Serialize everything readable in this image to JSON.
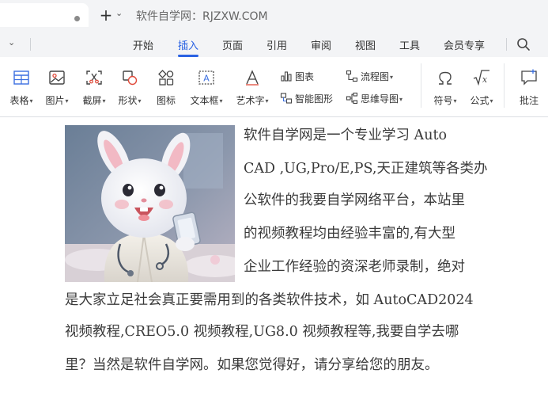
{
  "titlebar": {
    "new_tab_symbol": "+",
    "site_title": "软件自学网：RJZXW.COM"
  },
  "menu": {
    "items": [
      "开始",
      "插入",
      "页面",
      "引用",
      "审阅",
      "视图",
      "工具",
      "会员专享"
    ],
    "active": "插入"
  },
  "ribbon": {
    "table": "表格",
    "picture": "图片",
    "screenshot": "截屏",
    "shape": "形状",
    "icon": "图标",
    "textbox": "文本框",
    "wordart": "艺术字",
    "chart": "图表",
    "smartart": "智能图形",
    "flowchart": "流程图",
    "mindmap": "思维导图",
    "symbol": "符号",
    "formula": "公式",
    "comment": "批注"
  },
  "document": {
    "lines": [
      "软件自学网是一个专业学习 Auto",
      "CAD ,UG,Pro/E,PS,天正建筑等各类办",
      "公软件的我要自学网络平台，本站里",
      "的视频教程均由经验丰富的,有大型",
      "企业工作经验的资深老师录制，绝对",
      "是大家立足社会真正要需用到的各类软件技术，如 AutoCAD2024",
      "视频教程,CREO5.0 视频教程,UG8.0 视频教程等,我要自学去哪",
      "里？当然是软件自学网。如果您觉得好，请分享给您的朋友。"
    ]
  },
  "colors": {
    "accent": "#2a62e3",
    "chrome": "#f3f4f6",
    "text": "#333333"
  }
}
